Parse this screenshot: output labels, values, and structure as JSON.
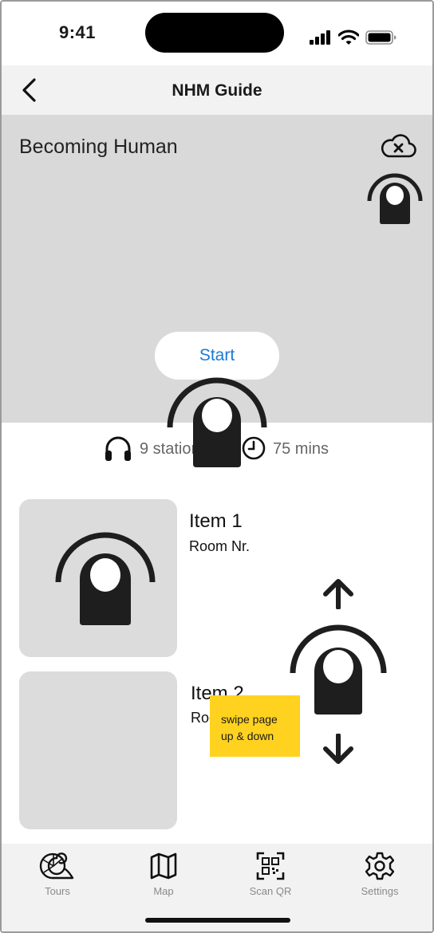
{
  "status_bar": {
    "time": "9:41"
  },
  "nav": {
    "title": "NHM Guide"
  },
  "tour": {
    "title": "Becoming Human",
    "start_label": "Start",
    "stations": "9 stations",
    "duration": "75 mins"
  },
  "items": [
    {
      "title": "Item 1",
      "subtitle": "Room Nr."
    },
    {
      "title": "Item 2",
      "subtitle": "Room Nr."
    }
  ],
  "hint": {
    "line1": "swipe page",
    "line2": "up & down"
  },
  "tabs": [
    {
      "label": "Tours",
      "icon": "nautilus-shell-icon"
    },
    {
      "label": "Map",
      "icon": "map-icon"
    },
    {
      "label": "Scan QR",
      "icon": "qr-scan-icon"
    },
    {
      "label": "Settings",
      "icon": "gear-icon"
    }
  ],
  "colors": {
    "accent": "#1a7ad6",
    "hint": "#ffd21f",
    "placeholder": "#d9d9d9"
  }
}
